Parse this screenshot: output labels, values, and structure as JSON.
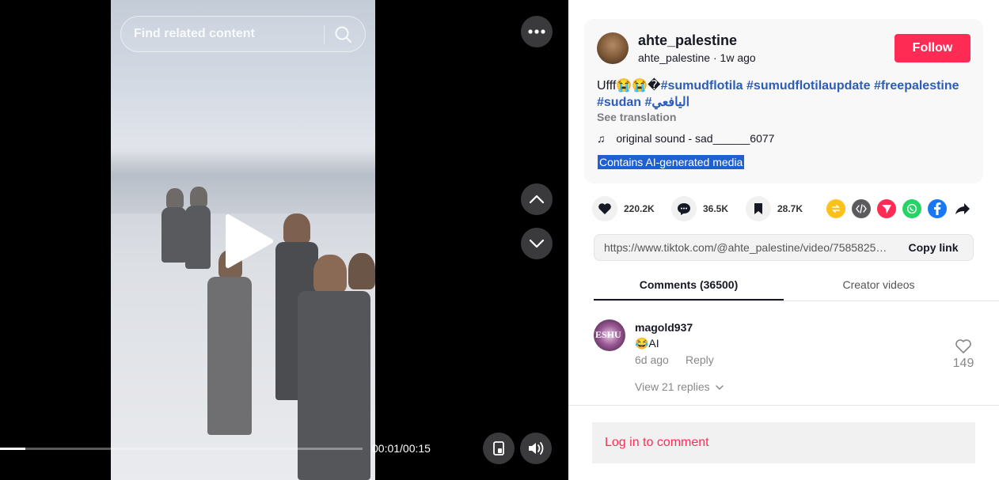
{
  "player": {
    "search_placeholder": "Find related content",
    "time": "00:01/00:15",
    "progress": 0.07
  },
  "author": {
    "name": "ahte_palestine",
    "handle": "ahte_palestine",
    "ago": "1w ago",
    "follow_label": "Follow"
  },
  "description": {
    "prefix": "Ufff😭😭�",
    "hashtags": [
      "#sumudflotila",
      "#sumudflotilaupdate",
      "#freepalestine",
      "#sudan",
      "#اليافعي"
    ],
    "see_translation": "See translation",
    "music": "original sound - sad______6077",
    "ai_label": "Contains AI-generated media"
  },
  "actions": {
    "likes": "220.2K",
    "comments": "36.5K",
    "saves": "28.7K"
  },
  "share_icons": [
    {
      "name": "repost-icon",
      "color": "#fcc21b"
    },
    {
      "name": "embed-icon",
      "color": "#5a5a5f"
    },
    {
      "name": "send-icon",
      "color": "#fe2c55"
    },
    {
      "name": "whatsapp-icon",
      "color": "#25d366"
    },
    {
      "name": "facebook-icon",
      "color": "#1877f2"
    },
    {
      "name": "share-arrow-icon",
      "color": "#161823"
    }
  ],
  "link": {
    "url": "https://www.tiktok.com/@ahte_palestine/video/7585825061396582661",
    "copy_label": "Copy link"
  },
  "tabs": {
    "comments": "Comments (36500)",
    "creator": "Creator videos"
  },
  "comment": {
    "avatar_text": "ESHU",
    "user": "magold937",
    "text": "😂AI",
    "time": "6d ago",
    "reply_label": "Reply",
    "likes": "149",
    "view_replies": "View 21 replies"
  },
  "login": {
    "label": "Log in to comment"
  },
  "colors": {
    "brand": "#fe2c55",
    "hashtag": "#2b5db9",
    "ai_highlight": "#1f5fcf"
  }
}
